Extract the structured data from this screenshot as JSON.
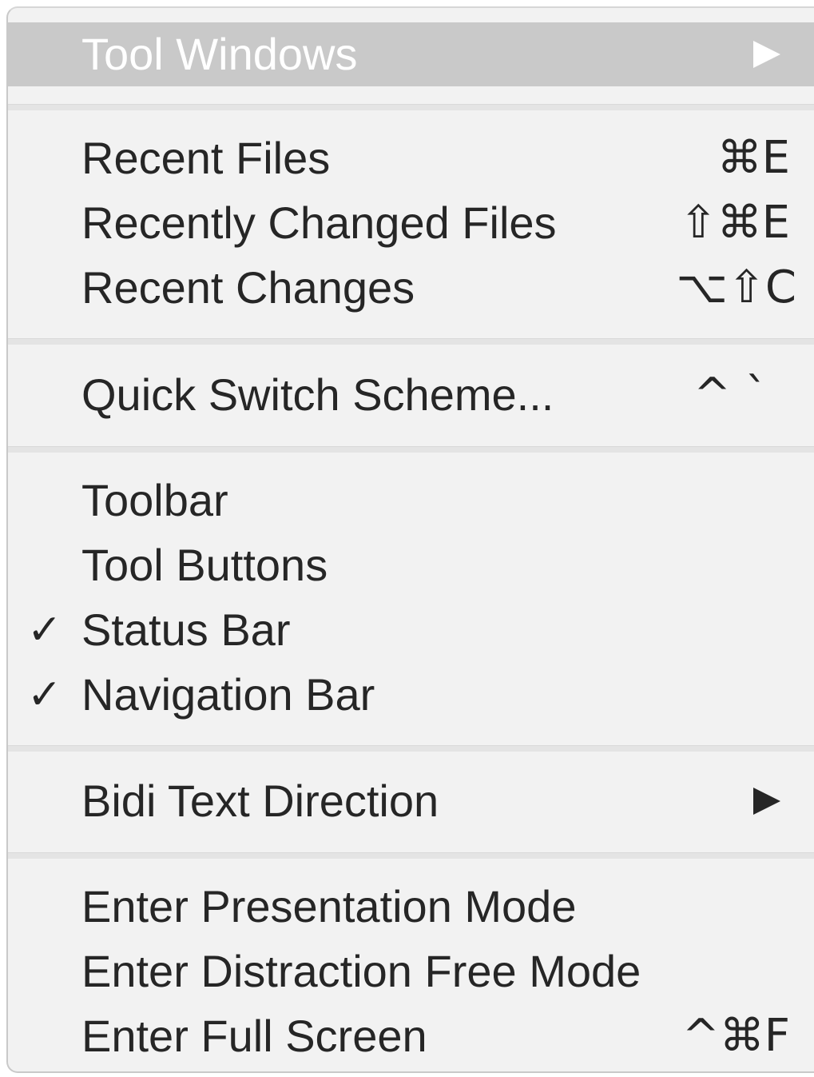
{
  "menu": {
    "tool_windows": {
      "label": "Tool Windows",
      "submenu_icon": "triangle-right-icon",
      "highlighted": true
    },
    "recent_files": {
      "label": "Recent Files",
      "shortcut": "⌘E"
    },
    "recently_changed_files": {
      "label": "Recently Changed Files",
      "shortcut": "⇧⌘E"
    },
    "recent_changes": {
      "label": "Recent Changes",
      "shortcut": "⌥⇧C"
    },
    "quick_switch_scheme": {
      "label": "Quick Switch Scheme...",
      "shortcut": "^`"
    },
    "toolbar": {
      "label": "Toolbar",
      "checked": false
    },
    "tool_buttons": {
      "label": "Tool Buttons",
      "checked": false
    },
    "status_bar": {
      "label": "Status Bar",
      "checked": true,
      "check_mark": "✓"
    },
    "navigation_bar": {
      "label": "Navigation Bar",
      "checked": true,
      "check_mark": "✓"
    },
    "bidi_text_direction": {
      "label": "Bidi Text Direction",
      "submenu_icon": "triangle-right-icon"
    },
    "enter_presentation_mode": {
      "label": "Enter Presentation Mode"
    },
    "enter_distraction_free_mode": {
      "label": "Enter Distraction Free Mode"
    },
    "enter_full_screen": {
      "label": "Enter Full Screen",
      "shortcut": "^⌘F"
    }
  },
  "colors": {
    "menu_background": "#f2f2f2",
    "highlight_background": "#c9c9c9",
    "text": "#262626",
    "highlight_text": "#ffffff",
    "separator": "#e4e4e4"
  }
}
